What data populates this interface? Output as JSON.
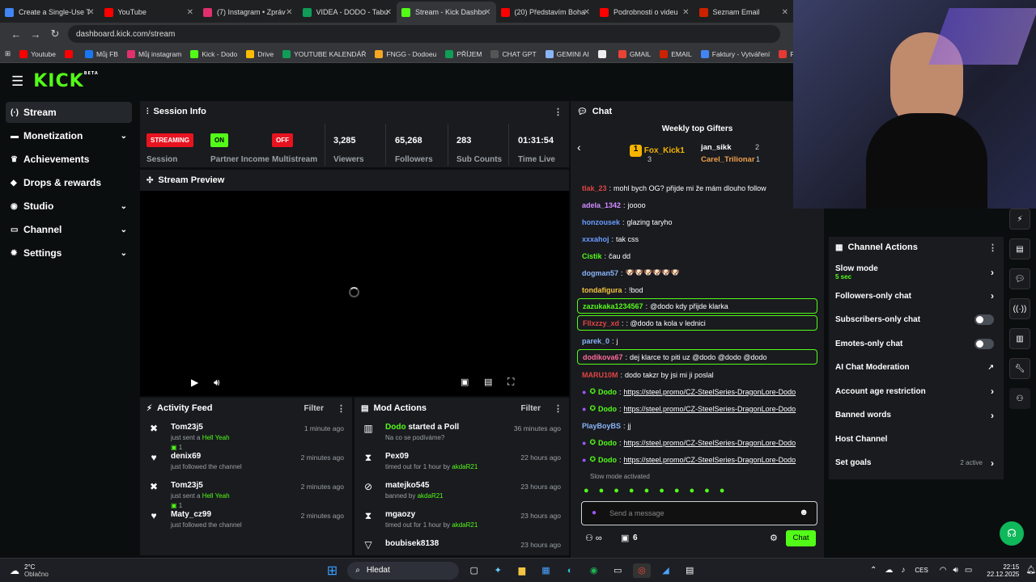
{
  "tabs": [
    {
      "title": "Create a Single-Use T",
      "color": "#4285f4",
      "active": false
    },
    {
      "title": "YouTube",
      "color": "#ff0000",
      "active": false
    },
    {
      "title": "(7) Instagram • Zpráv",
      "color": "#e1306c",
      "active": false
    },
    {
      "title": "VIDEA - DODO - Tabu",
      "color": "#0f9d58",
      "active": false
    },
    {
      "title": "Stream - Kick Dashbo",
      "color": "#53fc18",
      "active": true
    },
    {
      "title": "(20) Představím Boha",
      "color": "#ff0000",
      "active": false
    },
    {
      "title": "Podrobnosti o videu",
      "color": "#ff0000",
      "active": false
    },
    {
      "title": "Seznam Email",
      "color": "#cc2200",
      "active": false
    }
  ],
  "url": "dashboard.kick.com/stream",
  "bookmarks": [
    {
      "label": "Youtube",
      "color": "#ff0000"
    },
    {
      "label": "",
      "color": "#ff0000"
    },
    {
      "label": "Můj FB",
      "color": "#1877f2"
    },
    {
      "label": "Můj instagram",
      "color": "#e1306c"
    },
    {
      "label": "Kick - Dodo",
      "color": "#53fc18"
    },
    {
      "label": "Drive",
      "color": "#fbbc04"
    },
    {
      "label": "YOUTUBE KALENDÁŘ",
      "color": "#0f9d58"
    },
    {
      "label": "FNGG - Dodoeu",
      "color": "#f5a623"
    },
    {
      "label": "PŘÍJEM",
      "color": "#0f9d58"
    },
    {
      "label": "CHAT GPT",
      "color": "#555555"
    },
    {
      "label": "GEMINI AI",
      "color": "#8ab4f8"
    },
    {
      "label": "",
      "color": "#eeeeee"
    },
    {
      "label": "GMAIL",
      "color": "#ea4335"
    },
    {
      "label": "EMAIL",
      "color": "#cc2200"
    },
    {
      "label": "Faktury - Vytváření",
      "color": "#4285f4"
    },
    {
      "label": "PNG to PDF",
      "color": "#e53935"
    }
  ],
  "logo": "KICK",
  "logo_tag": "BETA",
  "sidebar": [
    {
      "label": "Stream",
      "icon": "(·)",
      "active": true,
      "chev": ""
    },
    {
      "label": "Monetization",
      "icon": "▬",
      "chev": "⌄"
    },
    {
      "label": "Achievements",
      "icon": "♛",
      "chev": ""
    },
    {
      "label": "Drops & rewards",
      "icon": "◆",
      "chev": ""
    },
    {
      "label": "Studio",
      "icon": "◉",
      "chev": "⌄"
    },
    {
      "label": "Channel",
      "icon": "▭",
      "chev": "⌄"
    },
    {
      "label": "Settings",
      "icon": "✹",
      "chev": "⌄"
    }
  ],
  "session": {
    "title": "Session Info",
    "streaming": "STREAMING",
    "session_label": "Session",
    "on": "ON",
    "partner_label": "Partner Income",
    "off": "OFF",
    "multistream_label": "Multistream",
    "viewers": "3,285",
    "viewers_label": "Viewers",
    "followers": "65,268",
    "followers_label": "Followers",
    "subs": "283",
    "subs_label": "Sub Counts",
    "time": "01:31:54",
    "time_label": "Time Live"
  },
  "preview": {
    "title": "Stream Preview"
  },
  "activity": {
    "title": "Activity Feed",
    "filter": "Filter",
    "items": [
      {
        "name": "Tom23j5",
        "sub": "just sent a",
        "hl": "Hell Yeah",
        "count": "1",
        "time": "1 minute ago",
        "icon": "✖"
      },
      {
        "name": "denix69",
        "sub": "just followed the channel",
        "hl": "",
        "count": "",
        "time": "2 minutes ago",
        "icon": "♥"
      },
      {
        "name": "Tom23j5",
        "sub": "just sent a",
        "hl": "Hell Yeah",
        "count": "1",
        "time": "2 minutes ago",
        "icon": "✖"
      },
      {
        "name": "Maty_cz99",
        "sub": "just followed the channel",
        "hl": "",
        "count": "",
        "time": "2 minutes ago",
        "icon": "♥"
      }
    ]
  },
  "mod": {
    "title": "Mod Actions",
    "filter": "Filter",
    "items": [
      {
        "name": "Dodo",
        "action": "started a Poll",
        "sub": "Na co se podíváme?",
        "by": "",
        "time": "36 minutes ago",
        "icon": "▥"
      },
      {
        "name": "Pex09",
        "action": "",
        "sub": "timed out for 1 hour by",
        "by": "akdaR21",
        "time": "22 hours ago",
        "icon": "⧗"
      },
      {
        "name": "matejko545",
        "action": "",
        "sub": "banned by",
        "by": "akdaR21",
        "time": "23 hours ago",
        "icon": "⊘"
      },
      {
        "name": "mgaozy",
        "action": "",
        "sub": "timed out for 1 hour by",
        "by": "akdaR21",
        "time": "23 hours ago",
        "icon": "⧗"
      },
      {
        "name": "boubisek8138",
        "action": "",
        "sub": "",
        "by": "",
        "time": "23 hours ago",
        "icon": "▽"
      }
    ]
  },
  "chat": {
    "title": "Chat",
    "gifters_title": "Weekly top Gifters",
    "g1": "Fox_Kick1",
    "g1c": "3",
    "g2": "jan_sikk",
    "g2c": "2",
    "g3": "Carel_Trilionar",
    "g3c": "1",
    "messages": [
      {
        "u": "tlak_23",
        "uc": "#e04444",
        "t": "mohl bych OG? přijde mi že mám dlouho follow",
        "hl": false
      },
      {
        "u": "adela_1342",
        "uc": "#d28cff",
        "t": "joooo",
        "hl": false
      },
      {
        "u": "honzousek",
        "uc": "#6a9bff",
        "t": "glazing taryho",
        "hl": false
      },
      {
        "u": "xxxahoj",
        "uc": "#6a9bff",
        "t": "tak css",
        "hl": false
      },
      {
        "u": "Cistik",
        "uc": "#53fc18",
        "t": "čau dd",
        "hl": false
      },
      {
        "u": "dogman57",
        "uc": "#8ab4f8",
        "t": "🐶🐶🐶🐶🐶🐶",
        "hl": false
      },
      {
        "u": "tondafigura",
        "uc": "#f6c343",
        "t": "!bod",
        "hl": false
      },
      {
        "u": "zazukaka1234567",
        "uc": "#53fc18",
        "t": "@dodo kdy přijde klarka",
        "hl": true
      },
      {
        "u": "Fllxzzy_xd",
        "uc": "#e04444",
        "t": ": @dodo ta kola v lednici",
        "hl": true
      },
      {
        "u": "parek_0",
        "uc": "#8ab4f8",
        "t": "j",
        "hl": false
      },
      {
        "u": "dodikova67",
        "uc": "#ff6b9a",
        "t": "dej klarce to piti uz @dodo @dodo @dodo",
        "hl": true
      },
      {
        "u": "MARU10M",
        "uc": "#e04444",
        "t": "dodo takzr by jsi mi ji poslal",
        "hl": false
      },
      {
        "u": "Dodo",
        "uc": "#53fc18",
        "t": "https://steel.promo/CZ-SteelSeries-DragonLore-Dodo",
        "hl": false,
        "link": true
      },
      {
        "u": "Dodo",
        "uc": "#53fc18",
        "t": "https://steel.promo/CZ-SteelSeries-DragonLore-Dodo",
        "hl": false,
        "link": true
      },
      {
        "u": "PlayBoyBS",
        "uc": "#8ab4f8",
        "t": "jj",
        "hl": false
      },
      {
        "u": "Dodo",
        "uc": "#53fc18",
        "t": "https://steel.promo/CZ-SteelSeries-DragonLore-Dodo",
        "hl": false,
        "link": true
      },
      {
        "u": "Dodo",
        "uc": "#53fc18",
        "t": "https://steel.promo/CZ-SteelSeries-DragonLore-Dodo",
        "hl": false,
        "link": true
      }
    ],
    "slow": "Slow mode activated",
    "placeholder": "Send a message",
    "count": "6",
    "send": "Chat"
  },
  "actions": {
    "title": "Channel Actions",
    "items": [
      {
        "label": "Slow mode",
        "sub": "5 sec",
        "ctrl": "arrow"
      },
      {
        "label": "Followers-only chat",
        "sub": "",
        "ctrl": "arrow"
      },
      {
        "label": "Subscribers-only chat",
        "sub": "",
        "ctrl": "toggle"
      },
      {
        "label": "Emotes-only chat",
        "sub": "",
        "ctrl": "toggle"
      },
      {
        "label": "AI Chat Moderation",
        "sub": "",
        "ctrl": "ext"
      },
      {
        "label": "Account age restriction",
        "sub": "",
        "ctrl": "arrow"
      },
      {
        "label": "Banned words",
        "sub": "",
        "ctrl": "arrow"
      },
      {
        "label": "Host Channel",
        "sub": "",
        "ctrl": ""
      },
      {
        "label": "Set goals",
        "sub": "",
        "ctrl": "arrow",
        "extra": "2 active"
      }
    ]
  },
  "taskbar": {
    "weather": "2°C",
    "weather_sub": "Oblačno",
    "search": "Hledat",
    "lang": "CES",
    "time": "22:15",
    "date": "22.12.2025"
  }
}
